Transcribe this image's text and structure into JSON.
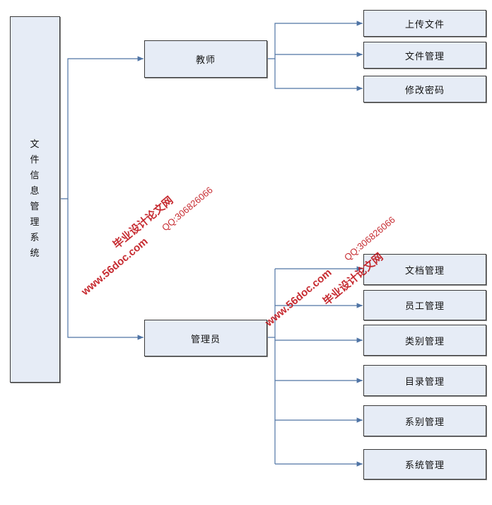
{
  "root": {
    "label": "文件信息管理系统",
    "chars": [
      "文",
      "件",
      "信",
      "息",
      "管",
      "理",
      "系",
      "统"
    ]
  },
  "roles": [
    {
      "label": "教师",
      "children": [
        "上传文件",
        "文件管理",
        "修改密码"
      ]
    },
    {
      "label": "管理员",
      "children": [
        "文档管理",
        "员工管理",
        "类别管理",
        "目录管理",
        "系别管理",
        "系统管理"
      ]
    }
  ],
  "watermarks": [
    {
      "site": "www.56doc.com",
      "name": "毕业设计论文网",
      "qq": "QQ:306826066"
    },
    {
      "site": "www.56doc.com",
      "name": "毕业设计论文网",
      "qq": "QQ:306826066"
    }
  ],
  "colors": {
    "box_fill": "#e6ecf6",
    "line": "#4f74a5",
    "watermark": "#c0141a"
  }
}
